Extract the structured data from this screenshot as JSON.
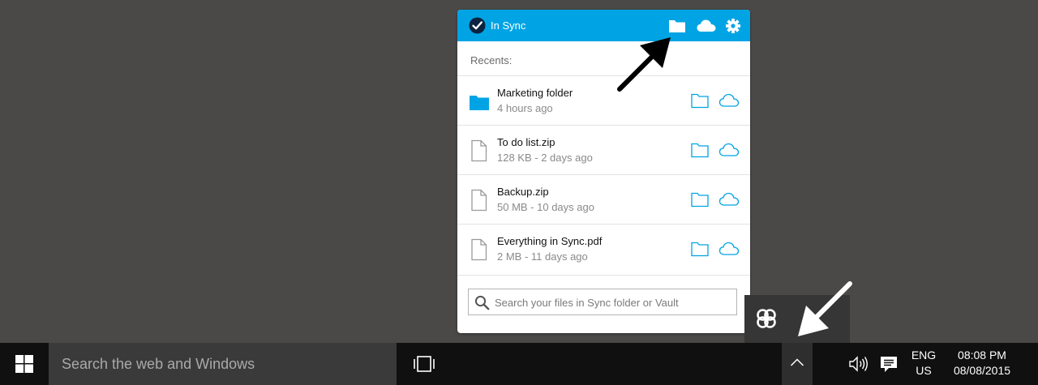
{
  "popup": {
    "status": "In Sync",
    "recents_label": "Recents:",
    "items": [
      {
        "name": "Marketing folder",
        "meta": "4 hours ago",
        "kind": "folder"
      },
      {
        "name": "To do list.zip",
        "meta": "128 KB - 2 days ago",
        "kind": "file"
      },
      {
        "name": "Backup.zip",
        "meta": "50 MB - 10 days ago",
        "kind": "file"
      },
      {
        "name": "Everything in Sync.pdf",
        "meta": "2 MB - 11 days ago",
        "kind": "file"
      }
    ],
    "search_placeholder": "Search your files in Sync folder or Vault"
  },
  "taskbar": {
    "search_text": "Search the web and Windows",
    "lang_line1": "ENG",
    "lang_line2": "US",
    "time": "08:08 PM",
    "date": "08/08/2015"
  },
  "colors": {
    "accent": "#00a4e4",
    "desktop": "#4b4948",
    "taskbar": "#101010"
  },
  "icons": [
    "check-icon",
    "folder-icon",
    "cloud-icon",
    "gear-icon",
    "file-icon",
    "search-icon",
    "sync-logo-icon",
    "windows-logo-icon",
    "task-view-icon",
    "chevron-up-icon",
    "volume-icon",
    "notifications-icon"
  ]
}
